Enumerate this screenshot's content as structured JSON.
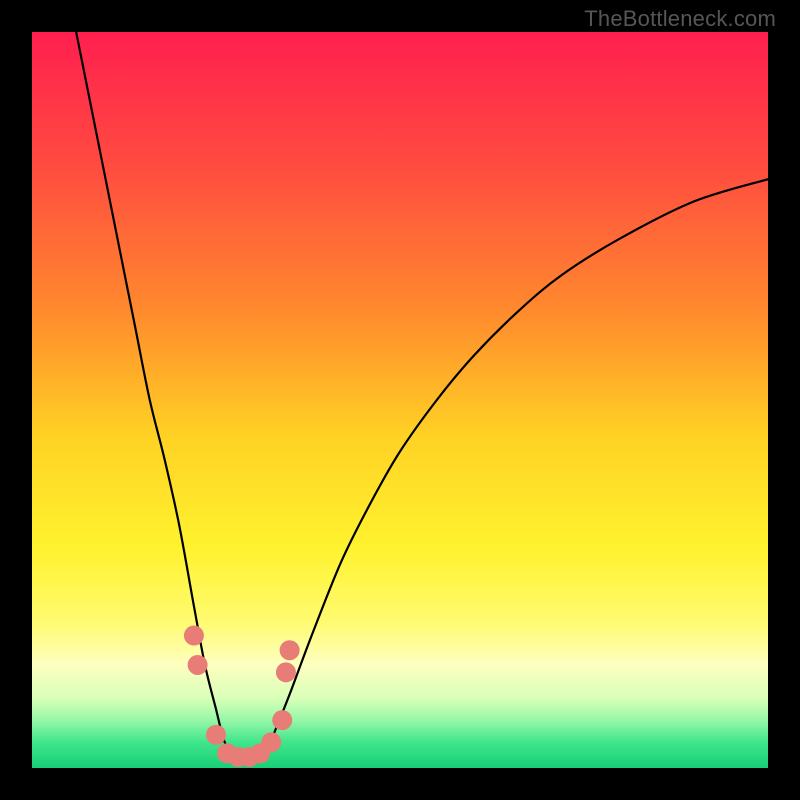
{
  "watermark": "TheBottleneck.com",
  "chart_data": {
    "type": "line",
    "title": "",
    "xlabel": "",
    "ylabel": "",
    "xlim": [
      0,
      100
    ],
    "ylim": [
      0,
      100
    ],
    "series": [
      {
        "name": "bottleneck-curve",
        "x": [
          6,
          8,
          10,
          12,
          14,
          16,
          18,
          20,
          22,
          23.5,
          25,
          26,
          27,
          28,
          29,
          30,
          31,
          32,
          33,
          35,
          38,
          42,
          46,
          50,
          55,
          60,
          66,
          72,
          80,
          90,
          100
        ],
        "y": [
          100,
          90,
          80,
          70,
          60,
          50,
          42,
          33,
          22,
          14,
          8,
          4,
          2,
          1,
          0.8,
          0.8,
          1.2,
          2.5,
          5,
          10,
          18,
          28,
          36,
          43,
          50,
          56,
          62,
          67,
          72,
          77,
          80
        ]
      }
    ],
    "markers": {
      "name": "highlighted-points",
      "color": "#e77d76",
      "points": [
        {
          "x": 22.0,
          "y": 18
        },
        {
          "x": 22.5,
          "y": 14
        },
        {
          "x": 25.0,
          "y": 4.5
        },
        {
          "x": 26.5,
          "y": 2.0
        },
        {
          "x": 28.0,
          "y": 1.5
        },
        {
          "x": 29.5,
          "y": 1.5
        },
        {
          "x": 31.0,
          "y": 2.0
        },
        {
          "x": 32.5,
          "y": 3.5
        },
        {
          "x": 34.0,
          "y": 6.5
        },
        {
          "x": 34.5,
          "y": 13
        },
        {
          "x": 35.0,
          "y": 16
        }
      ]
    },
    "gradient_stops": [
      {
        "offset": 0.0,
        "color": "#ff1f4f"
      },
      {
        "offset": 0.18,
        "color": "#ff4b40"
      },
      {
        "offset": 0.38,
        "color": "#ff8a2d"
      },
      {
        "offset": 0.55,
        "color": "#ffd224"
      },
      {
        "offset": 0.7,
        "color": "#fff22e"
      },
      {
        "offset": 0.8,
        "color": "#fffb6f"
      },
      {
        "offset": 0.86,
        "color": "#fdffc0"
      },
      {
        "offset": 0.905,
        "color": "#d9ffb8"
      },
      {
        "offset": 0.935,
        "color": "#97f7a8"
      },
      {
        "offset": 0.965,
        "color": "#3fe68b"
      },
      {
        "offset": 1.0,
        "color": "#18cf78"
      }
    ]
  }
}
